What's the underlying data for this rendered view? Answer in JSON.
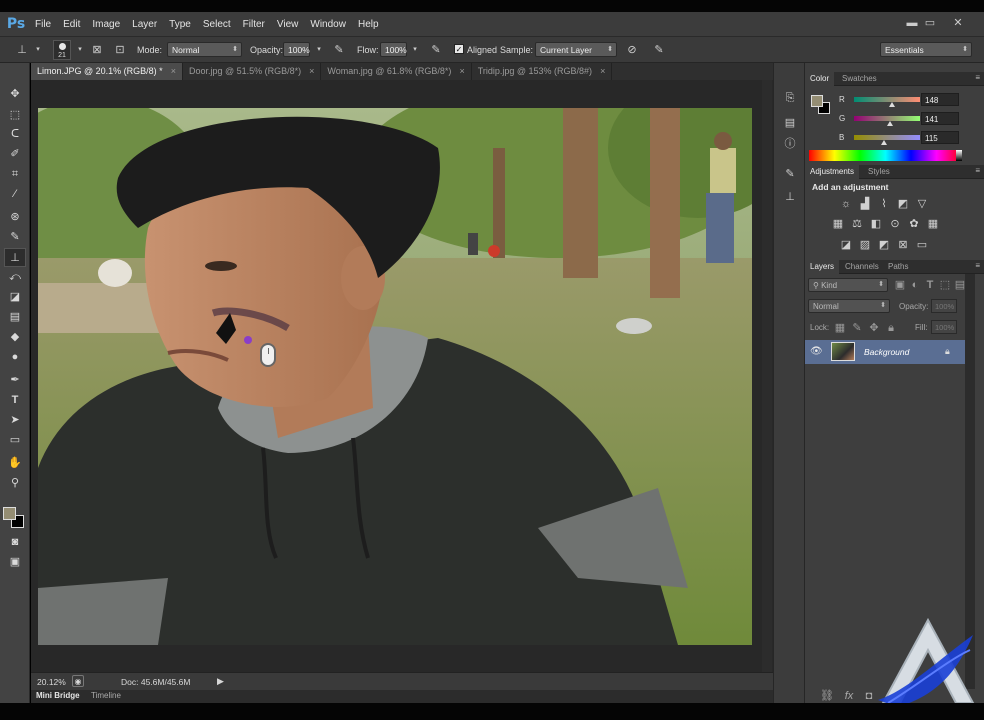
{
  "app": {
    "logo": "Ps"
  },
  "menu": [
    "File",
    "Edit",
    "Image",
    "Layer",
    "Type",
    "Select",
    "Filter",
    "View",
    "Window",
    "Help"
  ],
  "window_controls": {
    "minimize": "▬",
    "restore": "▭",
    "close": "✕"
  },
  "options": {
    "brush_size": "21",
    "mode_label": "Mode:",
    "mode_value": "Normal",
    "opacity_label": "Opacity:",
    "opacity_value": "100%",
    "flow_label": "Flow:",
    "flow_value": "100%",
    "aligned_label": "Aligned",
    "aligned_checked": true,
    "sample_label": "Sample:",
    "sample_value": "Current Layer",
    "workspace": "Essentials"
  },
  "tabs": [
    {
      "label": "Limon.JPG @ 20.1% (RGB/8) *",
      "active": true
    },
    {
      "label": "Door.jpg @ 51.5% (RGB/8*)",
      "active": false
    },
    {
      "label": "Woman.jpg @ 61.8% (RGB/8*)",
      "active": false
    },
    {
      "label": "Tridip.jpg @ 153% (RGB/8#)",
      "active": false
    }
  ],
  "status": {
    "zoom": "20.12%",
    "doc": "Doc: 45.6M/45.6M"
  },
  "bottom_tabs": [
    "Mini Bridge",
    "Timeline"
  ],
  "color_panel": {
    "tabs": [
      "Color",
      "Swatches"
    ],
    "channels": [
      {
        "label": "R",
        "value": "148",
        "level": 0.58
      },
      {
        "label": "G",
        "value": "141",
        "level": 0.55
      },
      {
        "label": "B",
        "value": "115",
        "level": 0.45
      }
    ],
    "foreground": "#948d73"
  },
  "adjustments_panel": {
    "tabs": [
      "Adjustments",
      "Styles"
    ],
    "heading": "Add an adjustment"
  },
  "layers_panel": {
    "tabs": [
      "Layers",
      "Channels",
      "Paths"
    ],
    "filter_label": "Kind",
    "blend_mode": "Normal",
    "opacity_label": "Opacity:",
    "opacity_value": "100%",
    "lock_label": "Lock:",
    "fill_label": "Fill:",
    "fill_value": "100%",
    "layers": [
      {
        "name": "Background",
        "visible": true,
        "locked": true
      }
    ]
  }
}
